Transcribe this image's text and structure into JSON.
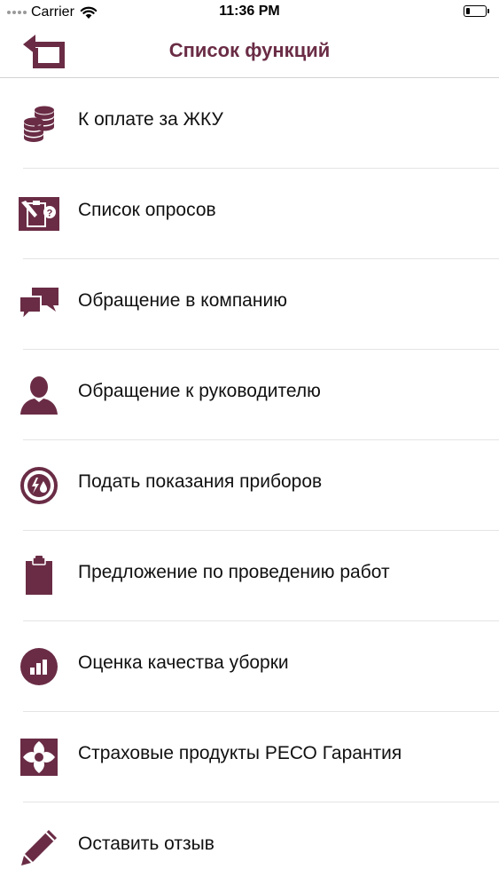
{
  "status_bar": {
    "carrier": "Carrier",
    "time": "11:36 PM",
    "battery_level": 0.2
  },
  "nav": {
    "title": "Список функций",
    "back_icon": "back-arrow-icon"
  },
  "menu": [
    {
      "label": "К оплате за ЖКУ",
      "icon": "coins-icon"
    },
    {
      "label": "Список опросов",
      "icon": "survey-icon"
    },
    {
      "label": "Обращение в компанию",
      "icon": "chat-bubbles-icon"
    },
    {
      "label": "Обращение к руководителю",
      "icon": "person-icon"
    },
    {
      "label": "Подать показания приборов",
      "icon": "meter-icon"
    },
    {
      "label": "Предложение по проведению работ",
      "icon": "clipboard-icon"
    },
    {
      "label": "Оценка качества уборки",
      "icon": "bar-chart-icon"
    },
    {
      "label": "Страховые продукты РЕСО Гарантия",
      "icon": "reso-logo-icon"
    },
    {
      "label": "Оставить отзыв",
      "icon": "pencil-icon"
    }
  ],
  "colors": {
    "accent": "#6a2c45",
    "text": "#111111",
    "divider": "#e4e4e4"
  }
}
